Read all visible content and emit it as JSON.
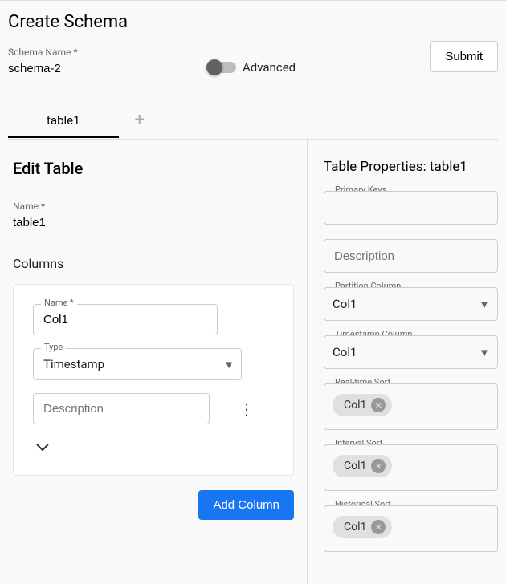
{
  "page": {
    "title": "Create Schema"
  },
  "header": {
    "schemaNameLabel": "Schema Name *",
    "schemaName": "schema-2",
    "advancedLabel": "Advanced",
    "submitLabel": "Submit"
  },
  "tabs": {
    "items": [
      "table1"
    ]
  },
  "editTable": {
    "title": "Edit Table",
    "nameLabel": "Name *",
    "nameValue": "table1",
    "columnsHeading": "Columns",
    "column": {
      "nameLabel": "Name *",
      "nameValue": "Col1",
      "typeLabel": "Type",
      "typeValue": "Timestamp",
      "descriptionPlaceholder": "Description"
    },
    "addColumnLabel": "Add Column"
  },
  "properties": {
    "title": "Table Properties: table1",
    "primaryKeysLabel": "Primary Keys",
    "descriptionPlaceholder": "Description",
    "partitionColumn": {
      "label": "Partition Column",
      "value": "Col1"
    },
    "timestampColumn": {
      "label": "Timestamp Column",
      "value": "Col1"
    },
    "realtimeSort": {
      "label": "Real-time Sort",
      "chips": [
        "Col1"
      ]
    },
    "intervalSort": {
      "label": "Interval Sort",
      "chips": [
        "Col1"
      ]
    },
    "historicalSort": {
      "label": "Historical Sort",
      "chips": [
        "Col1"
      ]
    }
  }
}
